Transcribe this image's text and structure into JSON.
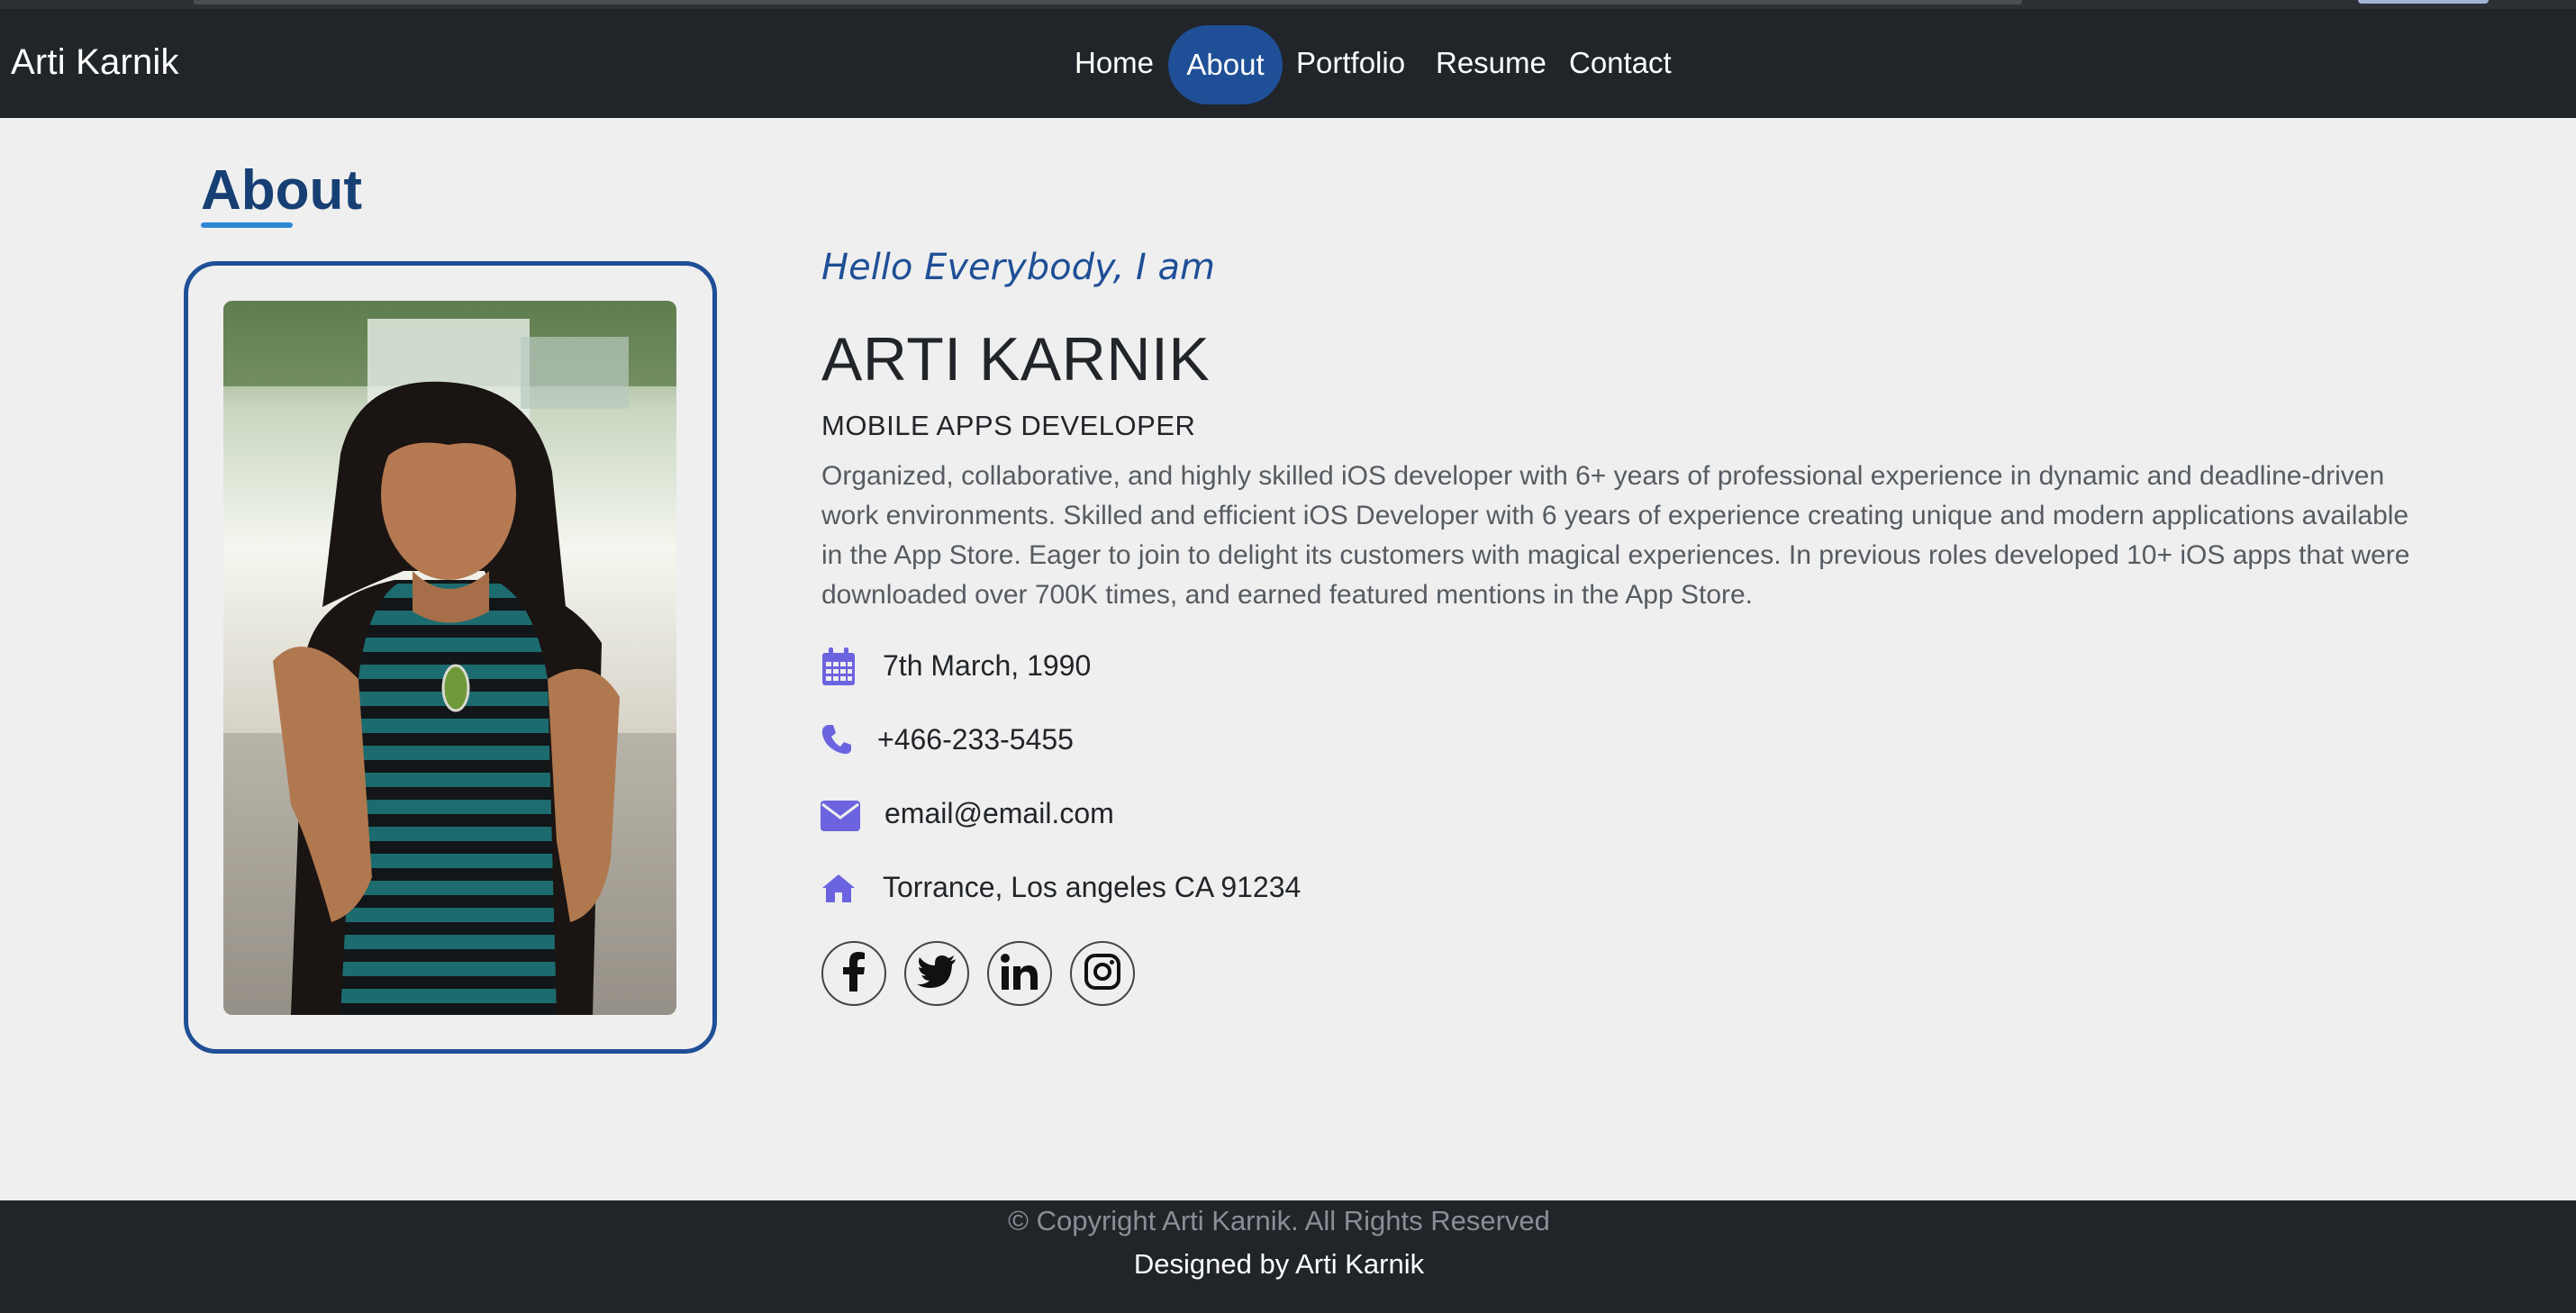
{
  "navbar": {
    "brand": "Arti Karnik",
    "items": [
      {
        "label": "Home",
        "active": false
      },
      {
        "label": "About",
        "active": true
      },
      {
        "label": "Portfolio",
        "active": false
      },
      {
        "label": "Resume",
        "active": false
      },
      {
        "label": "Contact",
        "active": false
      }
    ]
  },
  "about": {
    "title": "About",
    "greeting": "Hello Everybody, I am",
    "name": "ARTI KARNIK",
    "role": "MOBILE APPS DEVELOPER",
    "bio": "Organized, collaborative, and highly skilled iOS developer with 6+ years of professional experience in dynamic and deadline-driven work environments. Skilled and efficient iOS Developer with 6 years of experience creating unique and modern applications available in the App Store. Eager to join to delight its customers with magical experiences. In previous roles developed 10+ iOS apps that were downloaded over 700K times, and earned featured mentions in the App Store.",
    "info": [
      {
        "icon": "calendar-icon",
        "text": "7th March, 1990"
      },
      {
        "icon": "phone-icon",
        "text": "+466-233-5455"
      },
      {
        "icon": "envelope-icon",
        "text": "email@email.com"
      },
      {
        "icon": "home-icon",
        "text": "Torrance, Los angeles CA 91234"
      }
    ],
    "social": [
      "facebook-icon",
      "twitter-icon",
      "linkedin-icon",
      "instagram-icon"
    ]
  },
  "footer": {
    "copyright": "© Copyright Arti Karnik. All Rights Reserved",
    "designed": "Designed by Arti Karnik"
  },
  "colors": {
    "navbar_bg": "#212529",
    "accent": "#1f4f96",
    "title": "#163f74",
    "icon": "#6c63e0",
    "page_bg": "#efefef"
  }
}
